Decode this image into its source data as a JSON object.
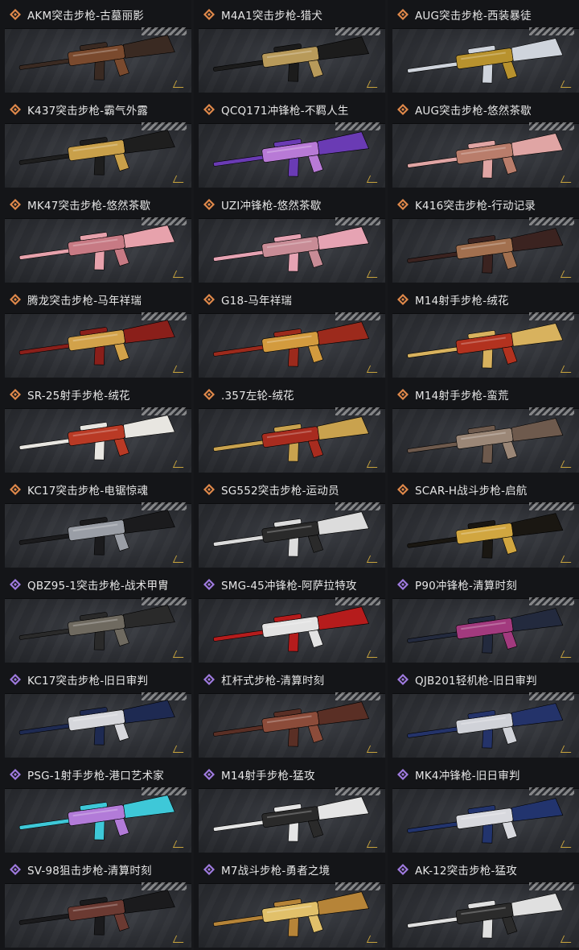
{
  "colors": {
    "rarity_orange": "#e0894a",
    "rarity_purple": "#a07be0",
    "text": "#e6e6e6"
  },
  "items": [
    {
      "name": "AKM突击步枪-古墓丽影",
      "rarity": "orange",
      "skin": [
        "#3a2a22",
        "#7a4a2e"
      ]
    },
    {
      "name": "M4A1突击步枪-猎犬",
      "rarity": "orange",
      "skin": [
        "#1c1c1c",
        "#b89a5a"
      ]
    },
    {
      "name": "AUG突击步枪-西装暴徒",
      "rarity": "orange",
      "skin": [
        "#cfd4dc",
        "#b8922e"
      ]
    },
    {
      "name": "K437突击步枪-霸气外露",
      "rarity": "orange",
      "skin": [
        "#1e1e1e",
        "#c9a04a"
      ]
    },
    {
      "name": "QCQ171冲锋枪-不羁人生",
      "rarity": "orange",
      "skin": [
        "#6a3bb4",
        "#b87ad6"
      ]
    },
    {
      "name": "AUG突击步枪-悠然茶歇",
      "rarity": "orange",
      "skin": [
        "#e0a5a4",
        "#b97d6b"
      ]
    },
    {
      "name": "MK47突击步枪-悠然茶歇",
      "rarity": "orange",
      "skin": [
        "#e7a2ac",
        "#c77a84"
      ]
    },
    {
      "name": "UZI冲锋枪-悠然茶歇",
      "rarity": "orange",
      "skin": [
        "#e6a3b3",
        "#c88c96"
      ]
    },
    {
      "name": "K416突击步枪-行动记录",
      "rarity": "orange",
      "skin": [
        "#3b2320",
        "#a2704f"
      ]
    },
    {
      "name": "腾龙突击步枪-马年祥瑞",
      "rarity": "orange",
      "skin": [
        "#8a1f1a",
        "#d2a24a"
      ]
    },
    {
      "name": "G18-马年祥瑞",
      "rarity": "orange",
      "skin": [
        "#9c2a1c",
        "#d39b3e"
      ]
    },
    {
      "name": "M14射手步枪-绒花",
      "rarity": "orange",
      "skin": [
        "#d8b25e",
        "#b2321f"
      ]
    },
    {
      "name": "SR-25射手步枪-绒花",
      "rarity": "orange",
      "skin": [
        "#e8e6e1",
        "#b93a25"
      ]
    },
    {
      "name": ".357左轮-绒花",
      "rarity": "orange",
      "skin": [
        "#c9a24e",
        "#a82c1f"
      ]
    },
    {
      "name": "M14射手步枪-蛮荒",
      "rarity": "orange",
      "skin": [
        "#6e5a4d",
        "#9b8777"
      ]
    },
    {
      "name": "KC17突击步枪-电锯惊魂",
      "rarity": "orange",
      "skin": [
        "#1b1b1d",
        "#9a9ea6"
      ]
    },
    {
      "name": "SG552突击步枪-运动员",
      "rarity": "orange",
      "skin": [
        "#dcdcdc",
        "#2a2a2a"
      ]
    },
    {
      "name": "SCAR-H战斗步枪-启航",
      "rarity": "orange",
      "skin": [
        "#1a1712",
        "#d1a640"
      ]
    },
    {
      "name": "QBZ95-1突击步枪-战术甲胄",
      "rarity": "purple",
      "skin": [
        "#2a2a2a",
        "#6f6a60"
      ]
    },
    {
      "name": "SMG-45冲锋枪-阿萨拉特攻",
      "rarity": "purple",
      "skin": [
        "#b51c1c",
        "#e3e3e3"
      ]
    },
    {
      "name": "P90冲锋枪-清算时刻",
      "rarity": "purple",
      "skin": [
        "#232a3e",
        "#a23a7e"
      ]
    },
    {
      "name": "KC17突击步枪-旧日审判",
      "rarity": "purple",
      "skin": [
        "#1e2a52",
        "#d6d7dc"
      ]
    },
    {
      "name": "杠杆式步枪-清算时刻",
      "rarity": "purple",
      "skin": [
        "#5a2f25",
        "#8c4c3a"
      ]
    },
    {
      "name": "QJB201轻机枪-旧日审判",
      "rarity": "purple",
      "skin": [
        "#24336a",
        "#d0d2d8"
      ]
    },
    {
      "name": "PSG-1射手步枪-港口艺术家",
      "rarity": "purple",
      "skin": [
        "#3ec8d8",
        "#b27bd8"
      ]
    },
    {
      "name": "M14射手步枪-猛攻",
      "rarity": "purple",
      "skin": [
        "#e5e5e5",
        "#2a2a2a"
      ]
    },
    {
      "name": "MK4冲锋枪-旧日审判",
      "rarity": "purple",
      "skin": [
        "#22346e",
        "#d8d9de"
      ]
    },
    {
      "name": "SV-98狙击步枪-清算时刻",
      "rarity": "purple",
      "skin": [
        "#1b1b1d",
        "#6b3a32"
      ]
    },
    {
      "name": "M7战斗步枪-勇者之境",
      "rarity": "purple",
      "skin": [
        "#b68438",
        "#e1c06a"
      ]
    },
    {
      "name": "AK-12突击步枪-猛攻",
      "rarity": "purple",
      "skin": [
        "#e0e0e0",
        "#2b2b2b"
      ]
    }
  ]
}
